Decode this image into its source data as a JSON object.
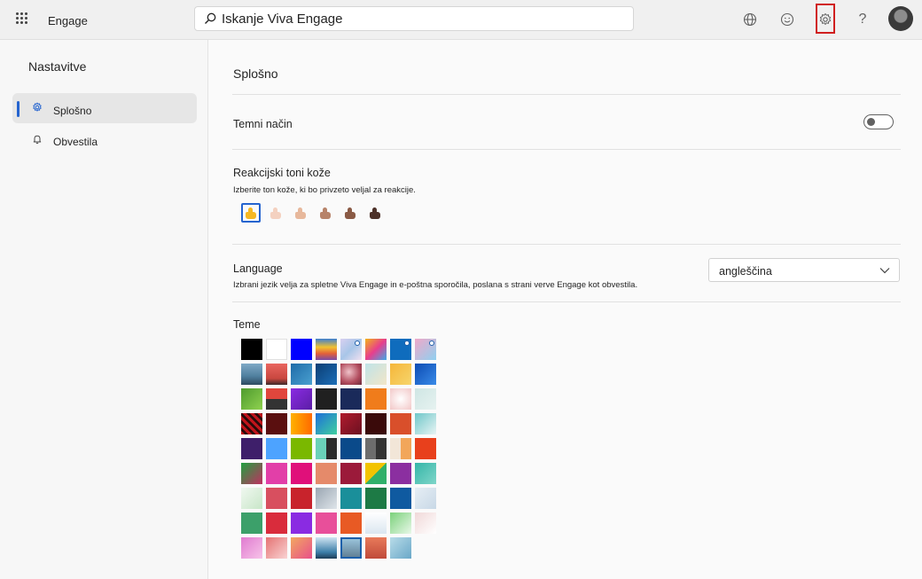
{
  "topbar": {
    "app_name": "Engage",
    "search_placeholder": "Iskanje Viva Engage",
    "icons": [
      "waffle-icon",
      "globe-icon",
      "smiley-icon",
      "gear-icon",
      "help-icon",
      "avatar"
    ],
    "help_glyph": "?"
  },
  "sidebar": {
    "title": "Nastavitve",
    "items": [
      {
        "label": "Splošno",
        "icon": "gear-icon",
        "active": true
      },
      {
        "label": "Obvestila",
        "icon": "bell-icon",
        "active": false
      }
    ]
  },
  "main": {
    "section_title": "Splošno",
    "dark_mode": {
      "label": "Temni način",
      "enabled": false
    },
    "skin_tones": {
      "label": "Reakcijski toni kože",
      "description": "Izberite ton kože, ki bo privzeto veljal za reakcije.",
      "tones": [
        "#f6b823",
        "#f4d1c0",
        "#e7b89c",
        "#b7836a",
        "#8a5a45",
        "#4d3129"
      ],
      "selected_index": 0
    },
    "language": {
      "label": "Language",
      "description": "Izbrani jezik velja za spletne Viva Engage in e-poštna sporočila, poslana s strani verve Engage kot obvestila.",
      "selected": "angleščina"
    },
    "themes": {
      "label": "Teme",
      "selected_index": 68,
      "tiles": [
        "#000000",
        "#ffffff",
        "#0000ff",
        "linear-gradient(180deg,#3d7fd1 0%,#f2c230 40%,#e2603a 70%,#7a4aa8 100%)",
        "linear-gradient(135deg,#d8d0f0,#a8c6e8 50%,#f0e0f0)",
        "linear-gradient(135deg,#f2b31a,#e83e8c 50%,#3fa9e8)",
        "#0f6cbd",
        "linear-gradient(135deg,#f0a8c8,#8fd0f0)",
        "linear-gradient(180deg,#7fa9c6 0%,#4f7f9e 60%,#2d4a5f 100%)",
        "linear-gradient(180deg,#e9655f 0%,#c9473f 70%,#3c2a2a 100%)",
        "linear-gradient(135deg,#1e6ba8,#4aa0d0)",
        "linear-gradient(135deg,#0b3d73,#1d6fb8)",
        "radial-gradient(circle at 40% 40%,#f0c2c9,#b04a5c 60%,#6b2a3a)",
        "linear-gradient(135deg,#bfe3e8,#f2e6c8)",
        "linear-gradient(135deg,#f5b63a,#f7d56b)",
        "linear-gradient(135deg,#0b4bb3,#3a8be8)",
        "linear-gradient(135deg,#4e9b2e,#8fd14f)",
        "linear-gradient(180deg,#e0463c 50%,#333 50%)",
        "linear-gradient(135deg,#8a2be2,#5b1ea6)",
        "#202020",
        "#1a2a5a",
        "#f07c1b",
        "radial-gradient(circle,#ffffff,#f2c7c7)",
        "linear-gradient(135deg,#cfe6e4,#e6f2f0)",
        "repeating-linear-gradient(45deg,#c0141b 0 3px,#2a0a0a 3px 6px)",
        "#5a0f0f",
        "linear-gradient(90deg,#ffb100,#ff6a00)",
        "linear-gradient(135deg,#1d6fd8,#3fd0a0)",
        "linear-gradient(135deg,#b01c2e,#6b1020)",
        "#3a0a0a",
        "#d94f2b",
        "linear-gradient(135deg,#6fc7c9,#e8f4f4)",
        "#3e1f6a",
        "#4da3ff",
        "#7ab800",
        "linear-gradient(90deg,#6ad1b8 50%,#2b2b2b 50%)",
        "#0a4a8a",
        "linear-gradient(90deg,#6d6d6d 50%,#333 50%)",
        "linear-gradient(90deg,#f2e6d8 50%,#f2a65a 50%)",
        "#e8401c",
        "linear-gradient(135deg,#20a040,#c03060)",
        "#e23fa8",
        "#e0107a",
        "#e58a6a",
        "#9b1a3a",
        "linear-gradient(135deg,#f2c300 50%,#2fb06a 50%)",
        "#8b2fa0",
        "linear-gradient(135deg,#35b5a8,#7fd6c9)",
        "linear-gradient(135deg,#f0f8f0,#c8e6c8)",
        "#d84f5f",
        "#c8232c",
        "linear-gradient(135deg,#9aa6b2,#dfe5ea)",
        "#1a8f9a",
        "#1d7a45",
        "#0f5aa0",
        "linear-gradient(135deg,#e6eef5,#c8d8e6)",
        "#3ca06a",
        "#d92c3c",
        "#8a2be2",
        "#e84f9a",
        "#e85a24",
        "linear-gradient(180deg,#ffffff 0%,#dbe6f0 100%)",
        "linear-gradient(135deg,#7bd17b,#e8f8e8)",
        "linear-gradient(135deg,#f0d8d8,#fff)",
        "linear-gradient(135deg,#e07bd0,#f7c3e8)",
        "linear-gradient(135deg,#e57373,#f9d3d3)",
        "linear-gradient(135deg,#f2a860,#e84f8a)",
        "linear-gradient(180deg,#cfe4f2 0%,#3c7ea8 70%,#1e3d56 100%)",
        "linear-gradient(180deg,#9ec8e0 0%,#5c7a8f 100%)",
        "linear-gradient(180deg,#e87a5a 0%,#c04a3a 100%)",
        "linear-gradient(135deg,#b8dbe8,#6aa8c8)"
      ],
      "dotted": [
        4,
        6,
        7
      ],
      "selected_label": "Teme"
    }
  },
  "colors": {
    "accent": "#2564cf",
    "highlight": "#d01f1f"
  }
}
